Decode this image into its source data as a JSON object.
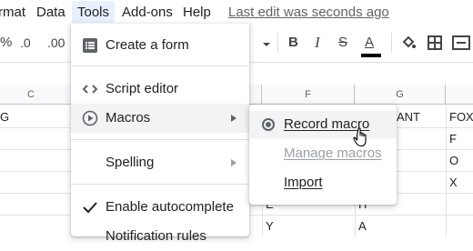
{
  "menubar": {
    "items": [
      "rmat",
      "Data",
      "Tools",
      "Add-ons",
      "Help"
    ],
    "last_edit": "Last edit was seconds ago"
  },
  "toolbar": {
    "percent": "%",
    "decimal_decrease": ".0",
    "decimal_increase": ".00",
    "bold": "B",
    "italic": "I",
    "strike": "S",
    "text_color": "A",
    "text_color_swatch": "#000000"
  },
  "grid": {
    "columns": [
      "C",
      "F",
      "G"
    ],
    "rows": [
      [
        "G",
        "",
        "ANT",
        "FOX"
      ],
      [
        "",
        "",
        "",
        "F"
      ],
      [
        "",
        "",
        "",
        "O"
      ],
      [
        "",
        "",
        "",
        "X"
      ],
      [
        "",
        "E",
        "H",
        ""
      ],
      [
        "",
        "Y",
        "A",
        ""
      ]
    ]
  },
  "tools_menu": {
    "items": {
      "create_form": "Create a form",
      "script_editor": "Script editor",
      "macros": "Macros",
      "spelling": "Spelling",
      "enable_autocomplete": "Enable autocomplete",
      "notification_rules": "Notification rules"
    }
  },
  "macros_submenu": {
    "record": "Record macro",
    "manage": "Manage macros",
    "import": "Import"
  }
}
